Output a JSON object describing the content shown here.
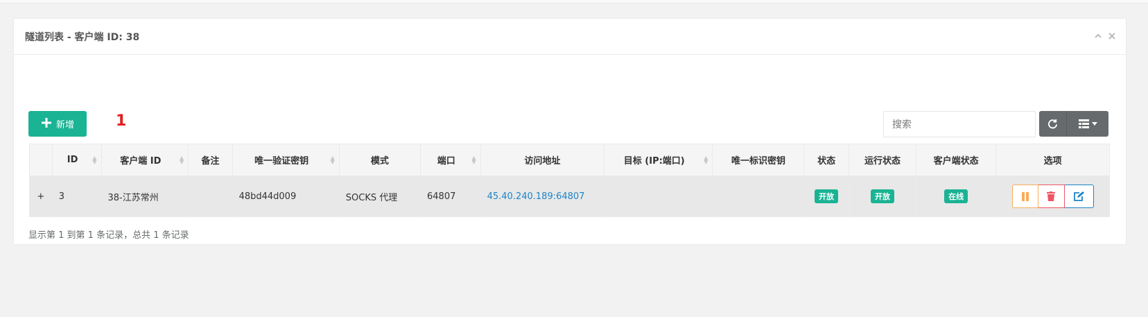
{
  "panel": {
    "title": "隧道列表 - 客户端 ID: 38",
    "collapse_icon": "chevron-up-icon",
    "close_icon": "close-icon"
  },
  "toolbar": {
    "add_label": "新增",
    "count_marker": "1",
    "search_placeholder": "搜索",
    "refresh_icon": "refresh-icon",
    "columns_icon": "columns-icon"
  },
  "table": {
    "headers": [
      "ID",
      "客户端 ID",
      "备注",
      "唯一验证密钥",
      "模式",
      "端口",
      "访问地址",
      "目标 (IP:端口)",
      "唯一标识密钥",
      "状态",
      "运行状态",
      "客户端状态",
      "选项"
    ],
    "rows": [
      {
        "id": "3",
        "client_id": "38-江苏常州",
        "remark": "",
        "verify_key": "48bd44d009",
        "mode": "SOCKS 代理",
        "port": "64807",
        "address": "45.40.240.189:64807",
        "target": "",
        "unique_key": "",
        "status": "开放",
        "run_status": "开放",
        "client_status": "在线"
      }
    ]
  },
  "footer": {
    "summary": "显示第 1 到第 1 条记录，总共 1 条记录"
  },
  "colors": {
    "primary": "#1ab394",
    "link": "#1c84c6",
    "warning": "#f8ac59",
    "danger": "#ed5565",
    "marker": "#e02020"
  }
}
